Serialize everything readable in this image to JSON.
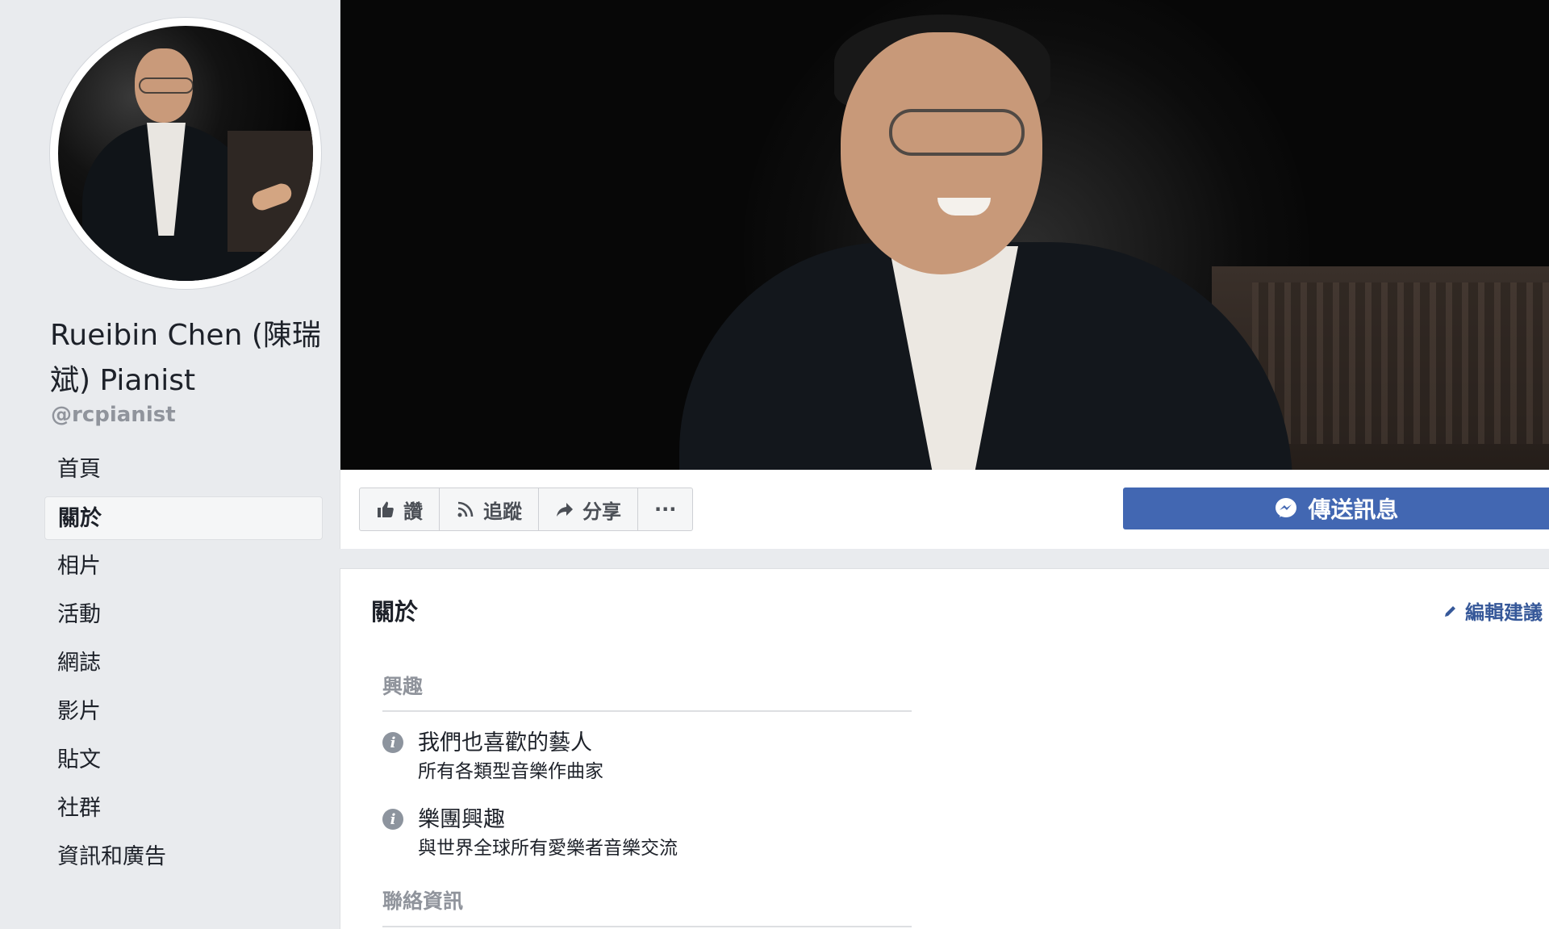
{
  "profile": {
    "name": "Rueibin Chen (陳瑞斌) Pianist",
    "handle": "@rcpianist"
  },
  "nav": {
    "items": [
      {
        "label": "首頁",
        "active": false
      },
      {
        "label": "關於",
        "active": true
      },
      {
        "label": "相片",
        "active": false
      },
      {
        "label": "活動",
        "active": false
      },
      {
        "label": "網誌",
        "active": false
      },
      {
        "label": "影片",
        "active": false
      },
      {
        "label": "貼文",
        "active": false
      },
      {
        "label": "社群",
        "active": false
      },
      {
        "label": "資訊和廣告",
        "active": false
      }
    ]
  },
  "actions": {
    "like": "讚",
    "follow": "追蹤",
    "share": "分享",
    "more": "···",
    "send_message": "傳送訊息"
  },
  "about": {
    "title": "關於",
    "edit_suggest": "編輯建議",
    "interests_heading": "興趣",
    "items": [
      {
        "title": "我們也喜歡的藝人",
        "subtitle": "所有各類型音樂作曲家"
      },
      {
        "title": "樂團興趣",
        "subtitle": "與世界全球所有愛樂者音樂交流"
      }
    ],
    "contact_heading": "聯絡資訊"
  },
  "colors": {
    "brand_blue": "#4267b2",
    "link_blue": "#365899",
    "page_bg": "#e9ebee"
  }
}
